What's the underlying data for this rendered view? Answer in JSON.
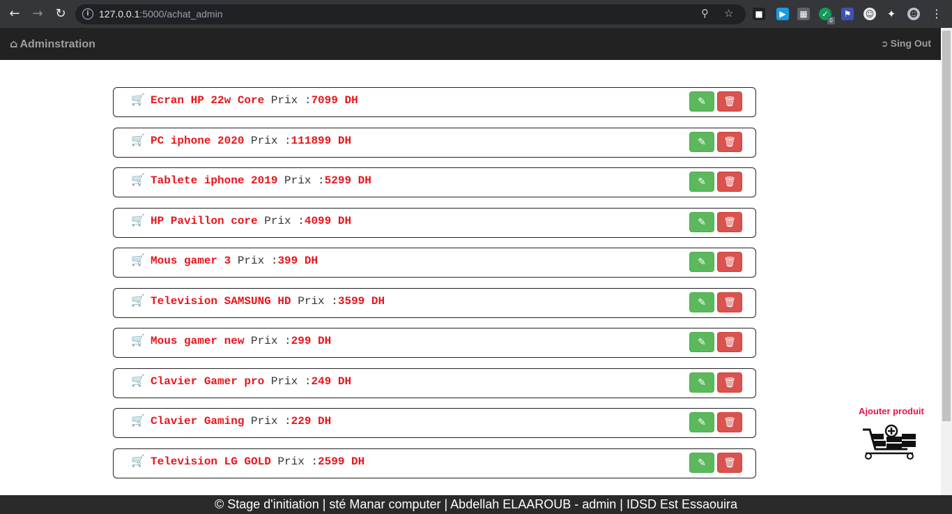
{
  "browser": {
    "url_host": "127.0.0.1",
    "url_path": ":5000/achat_admin",
    "ext_badge": "0"
  },
  "navbar": {
    "brand": "Adminstration",
    "signout": "Sing Out"
  },
  "products": [
    {
      "name": "Ecran HP 22w Core",
      "prix_label": " Prix :",
      "price": "7099 DH"
    },
    {
      "name": "PC iphone 2020",
      "prix_label": " Prix :",
      "price": "111899 DH"
    },
    {
      "name": "Tablete iphone 2019",
      "prix_label": " Prix :",
      "price": "5299 DH"
    },
    {
      "name": "HP Pavillon core",
      "prix_label": " Prix :",
      "price": "4099 DH"
    },
    {
      "name": "Mous gamer 3",
      "prix_label": " Prix :",
      "price": "399 DH"
    },
    {
      "name": "Television SAMSUNG HD",
      "prix_label": " Prix :",
      "price": "3599 DH"
    },
    {
      "name": "Mous gamer new",
      "prix_label": " Prix :",
      "price": "299 DH"
    },
    {
      "name": "Clavier Gamer pro",
      "prix_label": " Prix :",
      "price": "249 DH"
    },
    {
      "name": "Clavier Gaming",
      "prix_label": " Prix :",
      "price": "229 DH"
    },
    {
      "name": "Television LG GOLD",
      "prix_label": " Prix :",
      "price": "2599 DH"
    }
  ],
  "add_product": {
    "label": "Ajouter produit",
    "icon": "cart-add-icon"
  },
  "footer": {
    "text": "© Stage d'initiation | sté Manar computer | Abdellah ELAAROUB - admin | IDSD Est Essaouira"
  },
  "colors": {
    "accent_red": "#e8141b",
    "edit_green": "#5cb85c",
    "delete_red": "#d9534f",
    "navbar_bg": "#222222"
  }
}
